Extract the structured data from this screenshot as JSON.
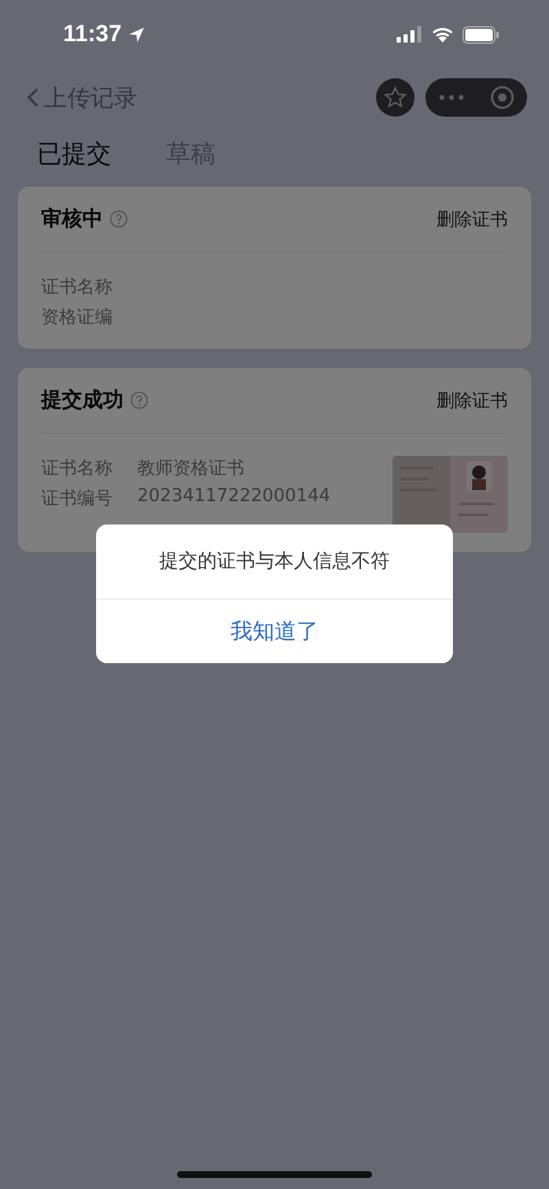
{
  "status_bar": {
    "time": "11:37"
  },
  "nav": {
    "title": "上传记录"
  },
  "tabs": [
    {
      "label": "已提交",
      "selected": true
    },
    {
      "label": "草稿",
      "selected": false
    }
  ],
  "cards": [
    {
      "status": "审核中",
      "action": "删除证书",
      "fields": [
        {
          "label": "证书名称"
        },
        {
          "label": "资格证编"
        }
      ],
      "has_photo": false
    },
    {
      "status": "提交成功",
      "action": "删除证书",
      "fields": [
        {
          "label": "证书名称",
          "value": "教师资格证书"
        },
        {
          "label": "证书编号",
          "value": "20234117222000144"
        }
      ],
      "has_photo": true
    }
  ],
  "dialog": {
    "message": "提交的证书与本人信息不符",
    "button": "我知道了"
  }
}
